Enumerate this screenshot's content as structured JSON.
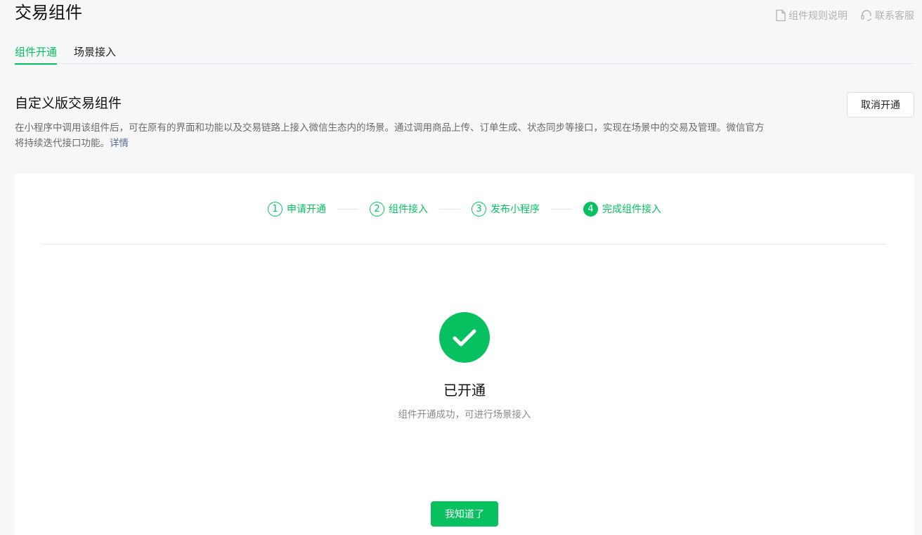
{
  "header": {
    "title": "交易组件",
    "links": [
      {
        "label": "组件规则说明",
        "icon": "document-icon"
      },
      {
        "label": "联系客服",
        "icon": "headset-icon"
      }
    ]
  },
  "tabs": [
    {
      "label": "组件开通",
      "active": true
    },
    {
      "label": "场景接入",
      "active": false
    }
  ],
  "section": {
    "title": "自定义版交易组件",
    "description": "在小程序中调用该组件后，可在原有的界面和功能以及交易链路上接入微信生态内的场景。通过调用商品上传、订单生成、状态同步等接口，实现在场景中的交易及管理。微信官方将持续迭代接口功能。",
    "detail_link": "详情",
    "cancel_button": "取消开通"
  },
  "steps": [
    {
      "number": "1",
      "label": "申请开通",
      "state": "completed"
    },
    {
      "number": "2",
      "label": "组件接入",
      "state": "completed"
    },
    {
      "number": "3",
      "label": "发布小程序",
      "state": "completed"
    },
    {
      "number": "4",
      "label": "完成组件接入",
      "state": "current"
    }
  ],
  "result": {
    "icon": "check-circle-icon",
    "title": "已开通",
    "description": "组件开通成功，可进行场景接入",
    "button": "我知道了"
  },
  "colors": {
    "accent": "#07c160",
    "link": "#576b95",
    "muted": "#b2b2b2"
  }
}
